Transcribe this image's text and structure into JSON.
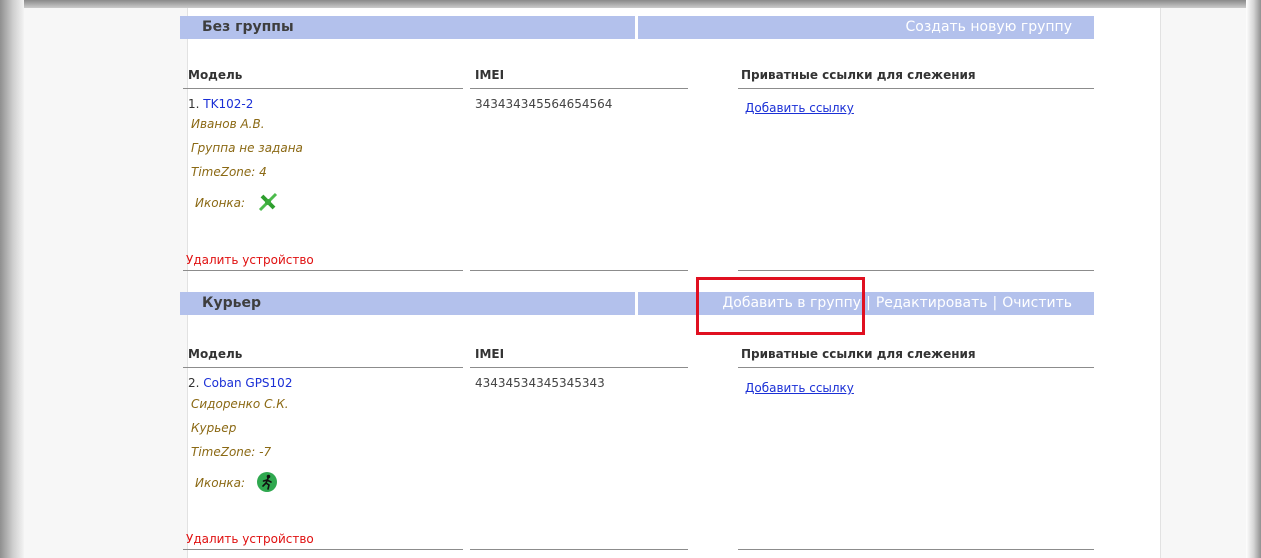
{
  "groups": [
    {
      "name": "Без группы",
      "actions": [
        "Создать новую группу"
      ],
      "columns": {
        "model": "Модель",
        "imei": "IMEI",
        "links": "Приватные ссылки для слежения"
      },
      "device": {
        "number": "1.",
        "model": "TK102-2",
        "owner": "Иванов А.В.",
        "group": "Группа не задана",
        "timezone": "TimeZone: 4",
        "icon_label": "Иконка:",
        "icon": "satellite-icon",
        "imei": "343434345564654564",
        "add_link": "Добавить ссылку",
        "delete": "Удалить устройство"
      }
    },
    {
      "name": "Курьер",
      "actions": [
        "Добавить в группу",
        "Редактировать",
        "Очистить"
      ],
      "separator": "|",
      "columns": {
        "model": "Модель",
        "imei": "IMEI",
        "links": "Приватные ссылки для слежения"
      },
      "device": {
        "number": "2.",
        "model": "Coban GPS102",
        "owner": "Сидоренко С.К.",
        "group": "Курьер",
        "timezone": "TimeZone: -7",
        "icon_label": "Иконка:",
        "icon": "running-man-icon",
        "imei": "43434534345345343",
        "add_link": "Добавить ссылку",
        "delete": "Удалить устройство"
      }
    }
  ],
  "colors": {
    "header_bg": "#b3c1ec",
    "link": "#1a2fd6",
    "meta": "#8b6914",
    "delete": "#e01010",
    "highlight": "#e01020"
  }
}
